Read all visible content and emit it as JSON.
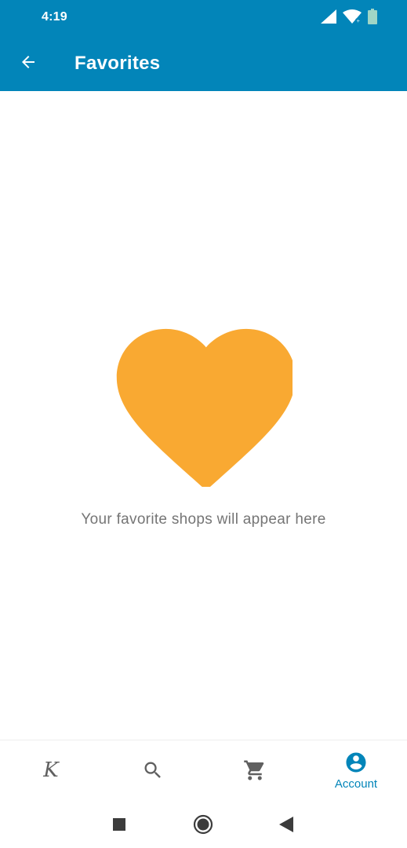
{
  "status_bar": {
    "time": "4:19",
    "icons": [
      "cellular-signal-icon",
      "wifi-icon",
      "battery-icon"
    ]
  },
  "app_bar": {
    "title": "Favorites",
    "back_icon": "arrow-back-icon"
  },
  "empty_state": {
    "icon": "heart-icon",
    "message": "Your favorite shops will appear here"
  },
  "bottom_nav": {
    "items": [
      {
        "id": "home",
        "icon": "brand-k-icon",
        "glyph": "K",
        "label": "",
        "active": false
      },
      {
        "id": "search",
        "icon": "search-icon",
        "label": "",
        "active": false
      },
      {
        "id": "cart",
        "icon": "cart-icon",
        "label": "",
        "active": false
      },
      {
        "id": "account",
        "icon": "account-circle-icon",
        "label": "Account",
        "active": true
      }
    ]
  },
  "system_nav": {
    "buttons": [
      "recents-square-icon",
      "home-circle-icon",
      "back-triangle-icon"
    ]
  },
  "colors": {
    "primary": "#0285b9",
    "heart": "#f9a932",
    "text_secondary": "#757575",
    "icon_inactive": "#606060"
  }
}
